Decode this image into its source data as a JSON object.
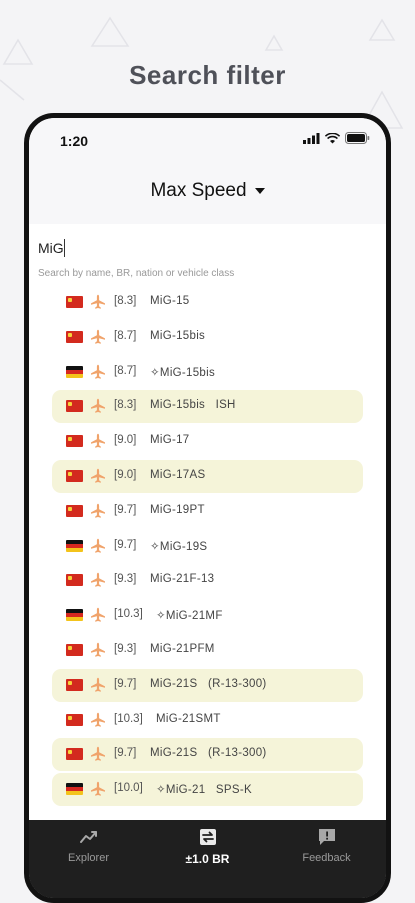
{
  "page": {
    "title": "Search filter"
  },
  "status_bar": {
    "time": "1:20",
    "icons": [
      "signal-icon",
      "wifi-icon",
      "battery-icon"
    ]
  },
  "header": {
    "sort_label": "Max Speed",
    "sort_icon": "caret-down-icon"
  },
  "search": {
    "value": "MiG",
    "hint": "Search by name, BR, nation or vehicle class"
  },
  "colors": {
    "highlight": "#f5f4d9",
    "accent_plane": "#f0a36b",
    "tabbar": "#1f1f1f",
    "ussr": "#d32a1e"
  },
  "vehicles": [
    {
      "nation": "USSR",
      "icon": "jet-icon",
      "br": "[8.3]",
      "name": "MiG-15",
      "highlighted": false
    },
    {
      "nation": "USSR",
      "icon": "jet-icon",
      "br": "[8.7]",
      "name": "MiG-15bis",
      "highlighted": false
    },
    {
      "nation": "Germany",
      "icon": "jet-icon",
      "br": "[8.7]",
      "name": "✧MiG-15bis",
      "highlighted": false
    },
    {
      "nation": "USSR",
      "icon": "jet-icon",
      "br": "[8.3]",
      "name": "MiG-15bis   ISH",
      "highlighted": true
    },
    {
      "nation": "USSR",
      "icon": "jet-icon",
      "br": "[9.0]",
      "name": "MiG-17",
      "highlighted": false
    },
    {
      "nation": "USSR",
      "icon": "jet-icon",
      "br": "[9.0]",
      "name": "MiG-17AS",
      "highlighted": true
    },
    {
      "nation": "USSR",
      "icon": "jet-icon",
      "br": "[9.7]",
      "name": "MiG-19PT",
      "highlighted": false
    },
    {
      "nation": "Germany",
      "icon": "jet-icon",
      "br": "[9.7]",
      "name": "✧MiG-19S",
      "highlighted": false
    },
    {
      "nation": "USSR",
      "icon": "jet-icon",
      "br": "[9.3]",
      "name": "MiG-21F-13",
      "highlighted": false
    },
    {
      "nation": "Germany",
      "icon": "jet-icon",
      "br": "[10.3]",
      "name": "✧MiG-21MF",
      "highlighted": false
    },
    {
      "nation": "USSR",
      "icon": "jet-icon",
      "br": "[9.3]",
      "name": "MiG-21PFM",
      "highlighted": false
    },
    {
      "nation": "USSR",
      "icon": "jet-icon",
      "br": "[9.7]",
      "name": "MiG-21S   (R-13-300)",
      "highlighted": true
    },
    {
      "nation": "USSR",
      "icon": "jet-icon",
      "br": "[10.3]",
      "name": "MiG-21SMT",
      "highlighted": false
    },
    {
      "nation": "USSR",
      "icon": "jet-icon",
      "br": "[9.7]",
      "name": "MiG-21S   (R-13-300)",
      "highlighted": true
    },
    {
      "nation": "Germany",
      "icon": "jet-icon",
      "br": "[10.0]",
      "name": "✧MiG-21   SPS-K",
      "highlighted": true
    }
  ],
  "tabbar": {
    "tabs": [
      {
        "label": "Explorer",
        "icon": "chart-line-icon",
        "active": false
      },
      {
        "label": "±1.0 BR",
        "icon": "swap-icon",
        "active": true
      },
      {
        "label": "Feedback",
        "icon": "feedback-icon",
        "active": false
      }
    ]
  }
}
